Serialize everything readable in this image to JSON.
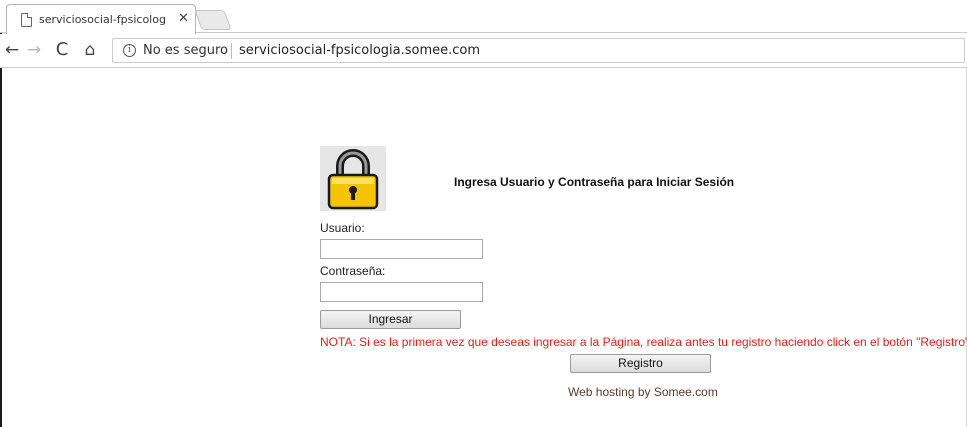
{
  "browser": {
    "tab": {
      "title": "serviciosocial-fpsicologia",
      "close_glyph": "✕",
      "icon": "page-icon"
    },
    "toolbar": {
      "back_glyph": "←",
      "forward_glyph": "→",
      "reload_glyph": "C",
      "home_glyph": "⌂",
      "info_glyph": "i",
      "security_label": "No es seguro",
      "url": "serviciosocial-fpsicologia.somee.com"
    }
  },
  "login": {
    "lock_icon": "padlock-icon",
    "title": "Ingresa Usuario y Contraseña para Iniciar Sesión",
    "user_label": "Usuario:",
    "user_value": "",
    "password_label": "Contraseña:",
    "password_value": "",
    "login_button": "Ingresar",
    "note": "NOTA: Si es la primera vez que deseas ingresar a la Página, realiza antes tu registro haciendo click en el botón \"Registro\".",
    "register_button": "Registro",
    "footer": "Web hosting by Somee.com"
  },
  "colors": {
    "note_red": "#e32019",
    "lock_yellow": "#f5c400",
    "footer_brown": "#5b3a2a"
  }
}
